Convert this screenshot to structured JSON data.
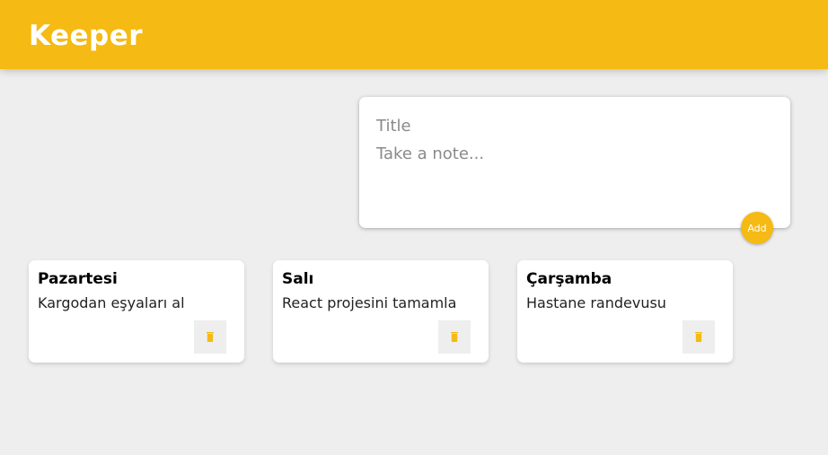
{
  "header": {
    "app_title": "Keeper"
  },
  "create_area": {
    "title_placeholder": "Title",
    "content_placeholder": "Take a note...",
    "add_label": "Add"
  },
  "notes": [
    {
      "title": "Pazartesi",
      "content": "Kargodan eşyaları al"
    },
    {
      "title": "Salı",
      "content": "React projesini tamamla"
    },
    {
      "title": "Çarşamba",
      "content": "Hastane randevusu"
    }
  ],
  "colors": {
    "accent": "#f5ba13",
    "background": "#eeeeee",
    "card": "#ffffff"
  },
  "icons": {
    "delete": "trash-icon"
  }
}
